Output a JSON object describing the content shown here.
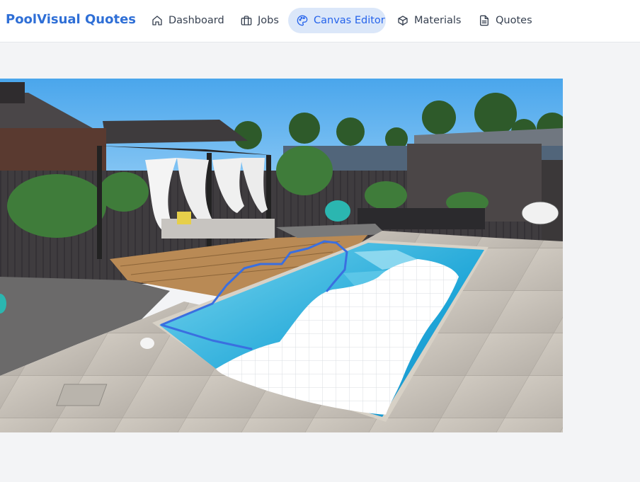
{
  "app": {
    "title": "PoolVisual Quotes"
  },
  "nav": {
    "items": [
      {
        "label": "Dashboard",
        "icon": "home-icon"
      },
      {
        "label": "Jobs",
        "icon": "briefcase-icon"
      },
      {
        "label": "Canvas Editor",
        "icon": "palette-icon",
        "active": true
      },
      {
        "label": "Materials",
        "icon": "box-icon"
      },
      {
        "label": "Quotes",
        "icon": "file-text-icon"
      }
    ]
  },
  "colors": {
    "brand": "#2f6fd6",
    "active_tab_bg": "#dbe7f9",
    "mask_outline": "#3a6fe0"
  }
}
